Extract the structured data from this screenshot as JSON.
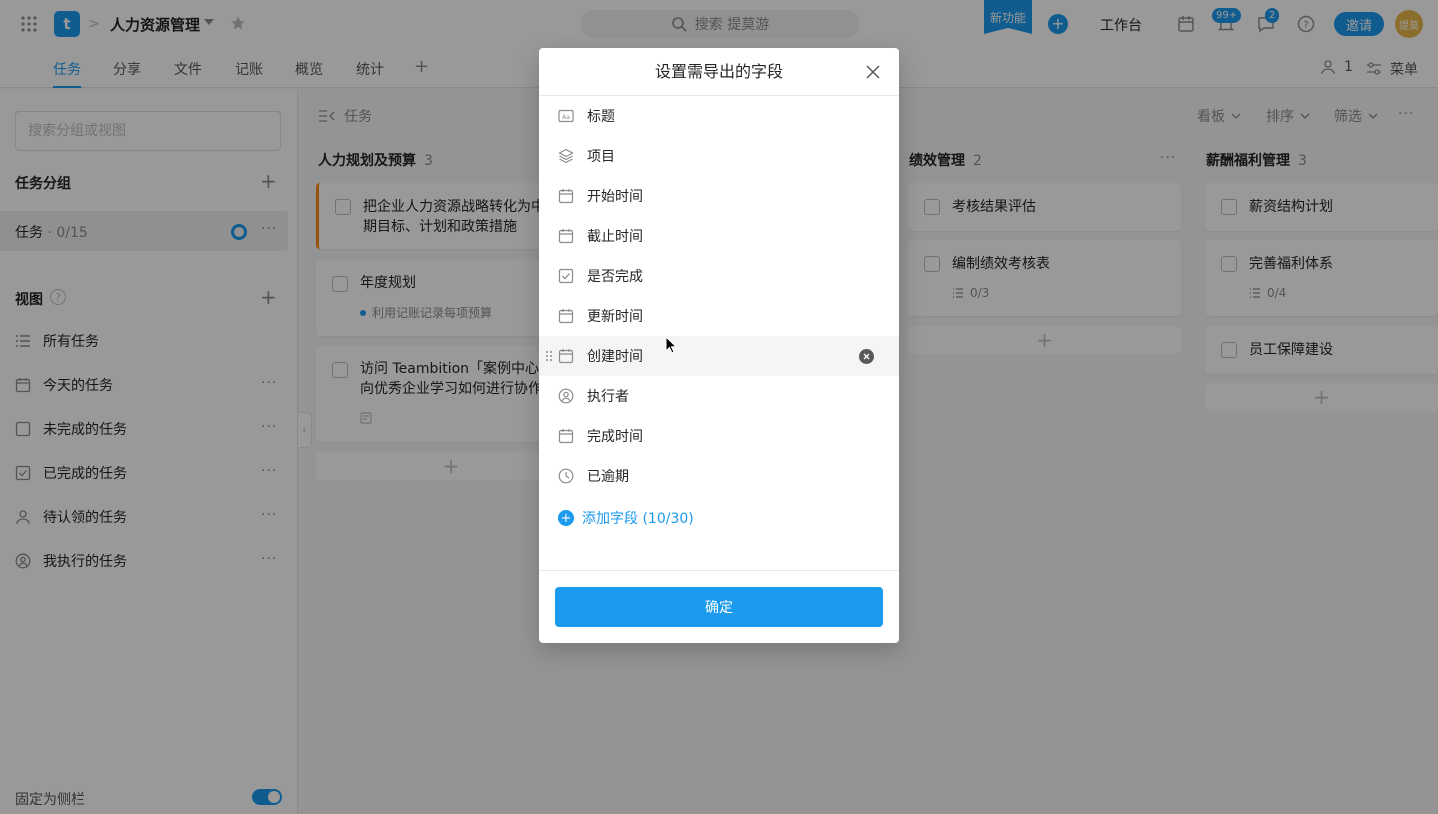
{
  "topbar": {
    "logo_letter": "t",
    "separator": ">",
    "project_name": "人力资源管理",
    "search_placeholder": "搜索 提莫游",
    "new_feature": "新功能",
    "workbench": "工作台",
    "notify_badge": "99+",
    "message_badge": "2",
    "invite": "邀请",
    "avatar_text": "提莫"
  },
  "tabs": [
    "任务",
    "分享",
    "文件",
    "记账",
    "概览",
    "统计"
  ],
  "tab_active": "任务",
  "tab_plus": "+",
  "members": {
    "count": "1"
  },
  "menu_label": "菜单",
  "sidebar": {
    "search_placeholder": "搜索分组或视图",
    "groups_heading": "任务分组",
    "group": {
      "name": "任务",
      "count": " · 0/15"
    },
    "views_heading": "视图",
    "views_help": "?",
    "views": [
      "所有任务",
      "今天的任务",
      "未完成的任务",
      "已完成的任务",
      "待认领的任务",
      "我执行的任务"
    ],
    "pin_label": "固定为侧栏"
  },
  "board": {
    "breadcrumb": "任务",
    "tools": [
      "看板",
      "排序",
      "筛选"
    ],
    "columns": [
      {
        "title": "人力规划及预算",
        "count": "3",
        "cards": [
          {
            "title": "把企业人力资源战略转化为中",
            "title2": "期目标、计划和政策措施"
          },
          {
            "title": "年度规划",
            "sub": "利用记账记录每项预算"
          },
          {
            "title": "访问 Teambition「案例中心」",
            "title2": "向优秀企业学习如何进行协作"
          }
        ]
      },
      {
        "title": "绩效管理",
        "count": "2",
        "cards": [
          {
            "title": "考核结果评估"
          },
          {
            "title": "编制绩效考核表",
            "sub": "0/3"
          }
        ]
      },
      {
        "title": "薪酬福利管理",
        "count": "3",
        "cards": [
          {
            "title": "薪资结构计划"
          },
          {
            "title": "完善福利体系",
            "sub": "0/4"
          },
          {
            "title": "员工保障建设"
          }
        ]
      }
    ]
  },
  "modal": {
    "title": "设置需导出的字段",
    "fields": [
      {
        "label": "标题",
        "icon": "text-field-icon"
      },
      {
        "label": "项目",
        "icon": "layers-icon"
      },
      {
        "label": "开始时间",
        "icon": "calendar-icon"
      },
      {
        "label": "截止时间",
        "icon": "calendar-icon"
      },
      {
        "label": "是否完成",
        "icon": "checkbox-icon"
      },
      {
        "label": "更新时间",
        "icon": "calendar-icon"
      },
      {
        "label": "创建时间",
        "icon": "calendar-icon"
      },
      {
        "label": "执行者",
        "icon": "user-icon"
      },
      {
        "label": "完成时间",
        "icon": "calendar-icon"
      },
      {
        "label": "已逾期",
        "icon": "clock-icon"
      }
    ],
    "hovered_field": "创建时间",
    "add_field": "添加字段 (10/30)",
    "confirm": "确定"
  },
  "colors": {
    "accent": "#1b9aee",
    "highlight": "#fa8c16"
  }
}
